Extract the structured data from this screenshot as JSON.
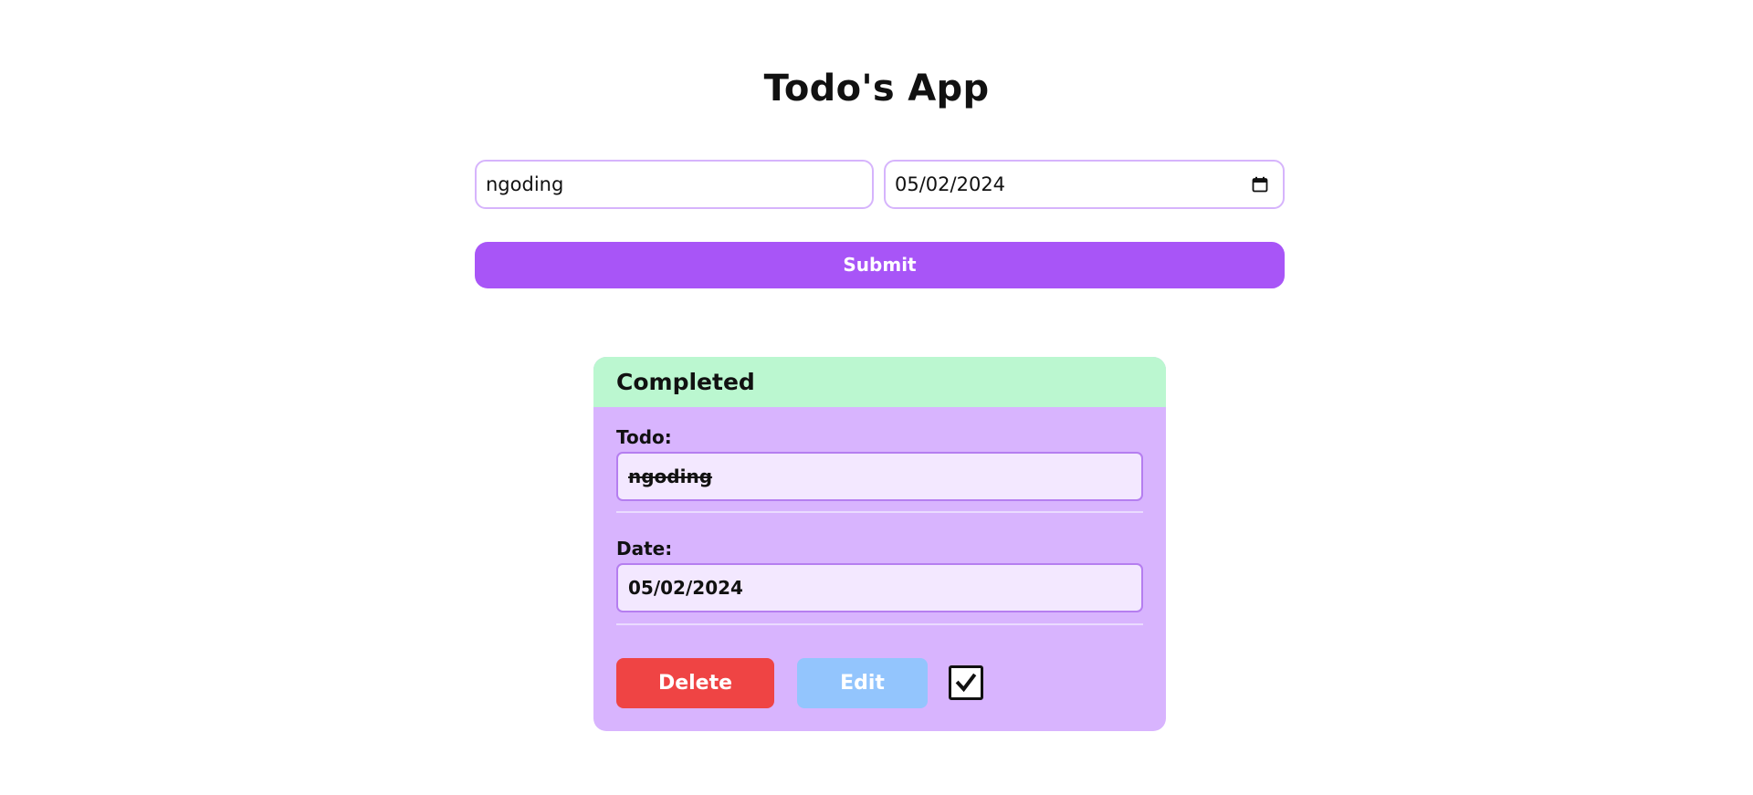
{
  "header": {
    "title": "Todo's App"
  },
  "form": {
    "todo_value": "ngoding",
    "date_value": "05/02/2024",
    "submit_label": "Submit"
  },
  "card": {
    "status": "Completed",
    "todo_label": "Todo:",
    "todo_value": "ngoding",
    "date_label": "Date:",
    "date_value": "05/02/2024",
    "delete_label": "Delete",
    "edit_label": "Edit",
    "completed_checked": true
  },
  "colors": {
    "accent": "#a855f7",
    "card_bg": "#d8b4fe",
    "header_bg": "#bbf7d0",
    "delete": "#ef4444",
    "edit": "#93c5fd"
  },
  "icons": {
    "date_picker": "calendar-icon",
    "checkbox": "checkmark-icon"
  }
}
